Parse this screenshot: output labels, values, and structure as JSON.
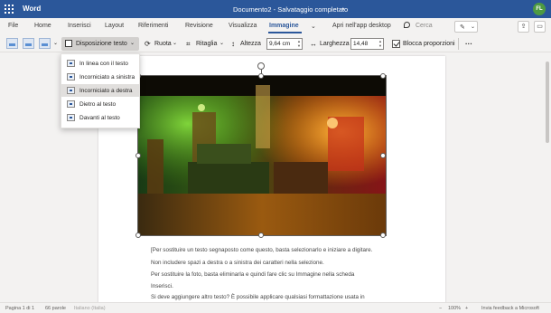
{
  "app": {
    "name": "Word",
    "doc_title": "Documento2  -  Salvataggio completato",
    "user_initials": "FL"
  },
  "tabs": [
    {
      "label": "File"
    },
    {
      "label": "Home"
    },
    {
      "label": "Inserisci"
    },
    {
      "label": "Layout"
    },
    {
      "label": "Riferimenti"
    },
    {
      "label": "Revisione"
    },
    {
      "label": "Visualizza"
    },
    {
      "label": "Immagine",
      "active": true
    }
  ],
  "open_desktop": "Apri nell'app desktop",
  "search": {
    "label": "Cerca"
  },
  "ribbon": {
    "wrap_text": "Disposizione testo",
    "rotate": "Ruota",
    "crop": "Ritaglia",
    "height_label": "Altezza",
    "height_value": "9,64 cm",
    "width_label": "Larghezza",
    "width_value": "14,48",
    "lock_ratio": "Blocca proporzioni",
    "more": "···"
  },
  "wrap_menu": {
    "items": [
      {
        "label": "In linea con il testo"
      },
      {
        "label": "Incorniciato a sinistra"
      },
      {
        "label": "Incorniciato a destra",
        "selected": true
      },
      {
        "label": "Dietro al testo"
      },
      {
        "label": "Davanti al testo"
      }
    ]
  },
  "document": {
    "paragraphs": [
      "[Per sostituire un testo segnaposto come questo, basta selezionarlo e iniziare a digitare.",
      "Non includere spazi a destra o a sinistra dei caratteri nella selezione.",
      "Per sostituire la foto, basta eliminarla e quindi fare clic su Immagine nella scheda",
      "Inserisci.",
      "Si deve aggiungere altro testo? È possibile applicare qualsiasi formattazione usata in"
    ]
  },
  "status": {
    "page": "Pagina 1 di 1",
    "words": "66 parole",
    "language": "Italiano (Italia)",
    "zoom_minus": "−",
    "zoom": "100%",
    "zoom_plus": "+",
    "feedback": "Invia feedback a Microsoft"
  },
  "colors": {
    "brand": "#2b579a",
    "ribbon_bg": "#f3f2f1",
    "avatar": "#4e9a42"
  },
  "icons": [
    "waffle-icon",
    "search-icon",
    "pen-icon",
    "share-icon",
    "comment-icon",
    "rotate-icon",
    "crop-icon",
    "height-icon",
    "width-icon"
  ]
}
